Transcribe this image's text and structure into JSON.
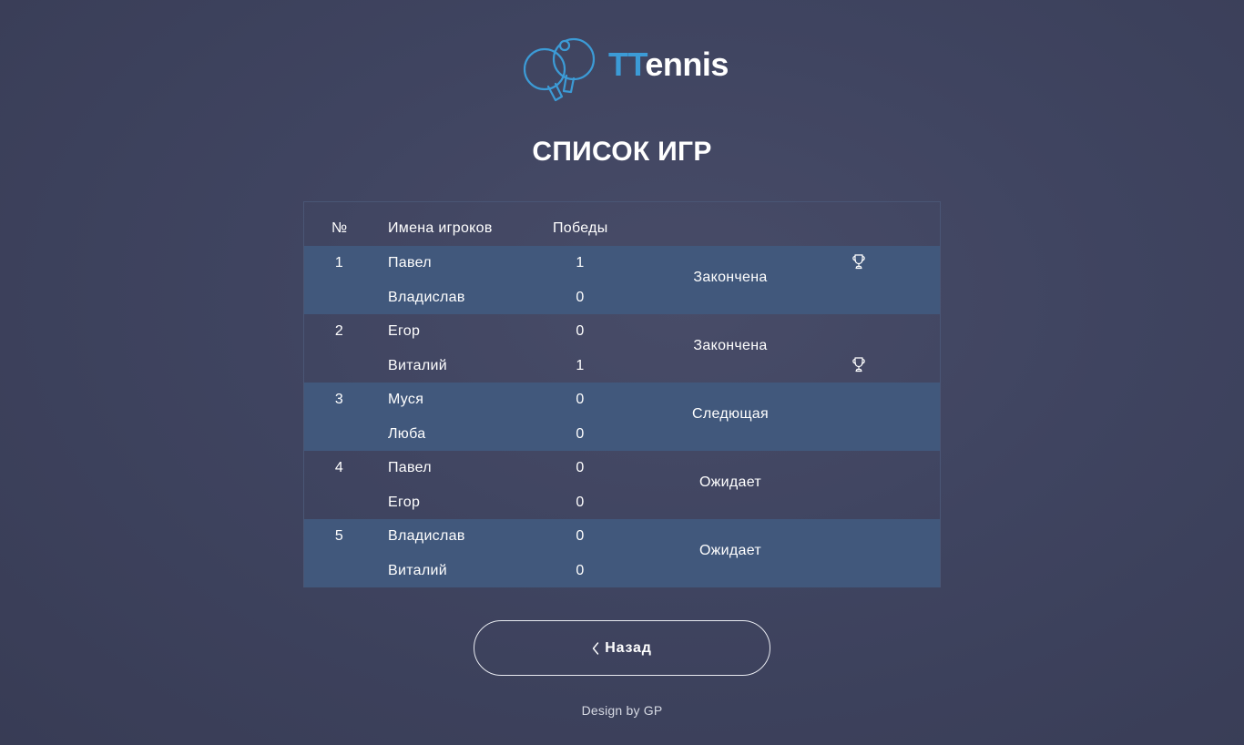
{
  "brand": {
    "accent": "TT",
    "rest": "ennis",
    "accent_color": "#3c9bd6"
  },
  "page_title": "СПИСОК ИГР",
  "table": {
    "headers": {
      "num": "№",
      "names": "Имена игроков",
      "wins": "Победы"
    },
    "games": [
      {
        "num": "1",
        "player1": "Павел",
        "player2": "Владислав",
        "wins1": "1",
        "wins2": "0",
        "status": "Закончена",
        "winner": 1
      },
      {
        "num": "2",
        "player1": "Егор",
        "player2": "Виталий",
        "wins1": "0",
        "wins2": "1",
        "status": "Закончена",
        "winner": 2
      },
      {
        "num": "3",
        "player1": "Муся",
        "player2": "Люба",
        "wins1": "0",
        "wins2": "0",
        "status": "Следющая",
        "winner": 0
      },
      {
        "num": "4",
        "player1": "Павел",
        "player2": "Егор",
        "wins1": "0",
        "wins2": "0",
        "status": "Ожидает",
        "winner": 0
      },
      {
        "num": "5",
        "player1": "Владислав",
        "player2": "Виталий",
        "wins1": "0",
        "wins2": "0",
        "status": "Ожидает",
        "winner": 0
      }
    ],
    "shaded_row_color": "#41587c"
  },
  "back_button": {
    "label": "Назад",
    "icon": "chevron-left-icon"
  },
  "footer": "Design by GP",
  "icons": {
    "logo": "ping-pong-paddles-icon",
    "winner": "trophy-icon"
  }
}
